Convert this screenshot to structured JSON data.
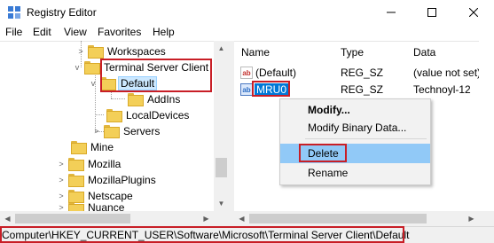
{
  "window": {
    "title": "Registry Editor"
  },
  "menu": [
    "File",
    "Edit",
    "View",
    "Favorites",
    "Help"
  ],
  "tree": {
    "items": [
      {
        "label": "Workspaces",
        "expander": ">"
      },
      {
        "label": "Terminal Server Client",
        "expander": "v"
      },
      {
        "label": "Default",
        "expander": "v"
      },
      {
        "label": "AddIns",
        "expander": ""
      },
      {
        "label": "LocalDevices",
        "expander": ""
      },
      {
        "label": "Servers",
        "expander": ">"
      },
      {
        "label": "Mine",
        "expander": ""
      },
      {
        "label": "Mozilla",
        "expander": ">"
      },
      {
        "label": "MozillaPlugins",
        "expander": ">"
      },
      {
        "label": "Netscape",
        "expander": ">"
      },
      {
        "label": "Nuance",
        "expander": ">"
      }
    ]
  },
  "values": {
    "columns": [
      "Name",
      "Type",
      "Data"
    ],
    "rows": [
      {
        "name": "(Default)",
        "type": "REG_SZ",
        "data": "(value not set)"
      },
      {
        "name": "MRU0",
        "type": "REG_SZ",
        "data": "Technoyl-12"
      }
    ]
  },
  "context_menu": {
    "items": [
      "Modify...",
      "Modify Binary Data...",
      "Delete",
      "Rename"
    ]
  },
  "status": {
    "path": "Computer\\HKEY_CURRENT_USER\\Software\\Microsoft\\Terminal Server Client\\Default"
  },
  "colors": {
    "highlight_box": "#c81e26",
    "selection": "#0078d7",
    "menu_hover": "#91c9f7"
  }
}
